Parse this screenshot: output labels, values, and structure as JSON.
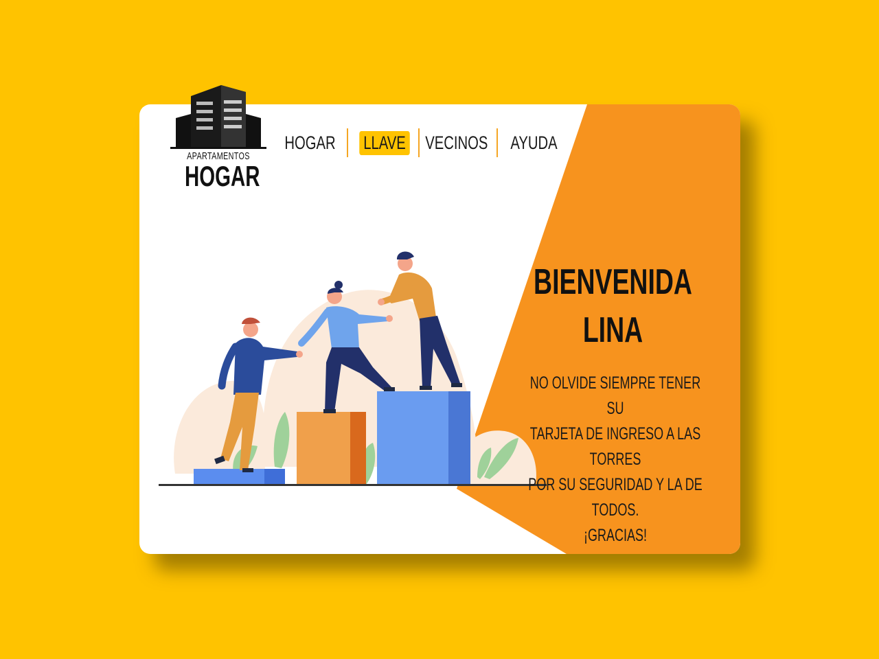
{
  "logo": {
    "subtitle": "APARTAMENTOS",
    "title": "HOGAR",
    "icon": "building-icon"
  },
  "nav": {
    "items": [
      {
        "label": "HOGAR",
        "active": false
      },
      {
        "label": "LLAVE",
        "active": true
      },
      {
        "label": "VECINOS",
        "active": false
      },
      {
        "label": "AYUDA",
        "active": false
      }
    ]
  },
  "welcome": {
    "line1": "BIENVENIDA",
    "line2": "LINA"
  },
  "message": {
    "line1": "NO OLVIDE SIEMPRE TENER SU",
    "line2": "TARJETA DE INGRESO A LAS TORRES",
    "line3": "POR SU SEGURIDAD Y LA DE TODOS.",
    "line4": "¡GRACIAS!"
  },
  "illustration": {
    "icon": "teamwork-illustration"
  },
  "colors": {
    "background": "#FFC300",
    "accent_orange": "#F7931E",
    "nav_highlight": "#FFC300",
    "separator": "#F5A623"
  }
}
